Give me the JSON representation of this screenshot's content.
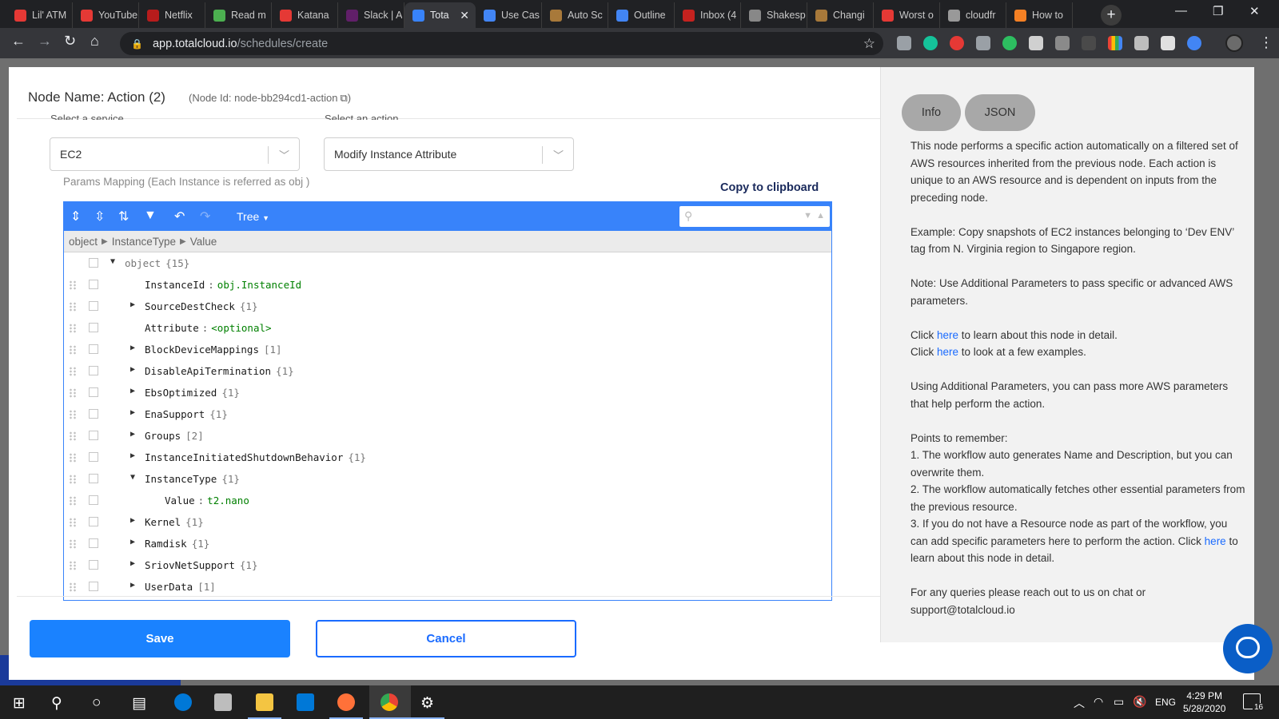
{
  "browser": {
    "tabs": [
      {
        "label": "Lil' ATM",
        "color": "#e53935"
      },
      {
        "label": "YouTube",
        "color": "#e53935"
      },
      {
        "label": "Netflix",
        "color": "#b71c1c"
      },
      {
        "label": "Read m",
        "color": "#4caf50"
      },
      {
        "label": "Katana",
        "color": "#e53935"
      },
      {
        "label": "Slack | A",
        "color": "#611f69"
      },
      {
        "label": "Tota",
        "color": "#3883fa",
        "active": true
      },
      {
        "label": "Use Cas",
        "color": "#4285f4"
      },
      {
        "label": "Auto Sc",
        "color": "#a8793a"
      },
      {
        "label": "Outline",
        "color": "#4285f4"
      },
      {
        "label": "Inbox (4",
        "color": "#c5221f"
      },
      {
        "label": "Shakesp",
        "color": "#888888"
      },
      {
        "label": "Changi",
        "color": "#a8793a"
      },
      {
        "label": "Worst o",
        "color": "#e53935"
      },
      {
        "label": "cloudfr",
        "color": "#999999"
      },
      {
        "label": "How to",
        "color": "#f48024"
      }
    ],
    "url_domain": "app.totalcloud.io",
    "url_path": "/schedules/create"
  },
  "modal": {
    "node_name": "Node Name: Action (2)",
    "node_id": "(Node Id: node-bb294cd1-action",
    "service_label": "Select a service",
    "action_label": "Select an action",
    "service_value": "EC2",
    "action_value": "Modify Instance Attribute",
    "params_label": "Params Mapping (Each Instance is referred as obj )",
    "copy_clipboard": "Copy to clipboard",
    "editor": {
      "mode": "Tree",
      "path": [
        "object",
        "InstanceType",
        "Value"
      ],
      "rows": [
        {
          "indent": 0,
          "expander": "open",
          "key": "object",
          "count": "{15}",
          "handle": false
        },
        {
          "indent": 1,
          "expander": "none",
          "key": "InstanceId",
          "value": "obj.InstanceId"
        },
        {
          "indent": 1,
          "expander": "closed",
          "key": "SourceDestCheck",
          "count": "{1}"
        },
        {
          "indent": 1,
          "expander": "none",
          "key": "Attribute",
          "value": "<optional>"
        },
        {
          "indent": 1,
          "expander": "closed",
          "key": "BlockDeviceMappings",
          "count": "[1]"
        },
        {
          "indent": 1,
          "expander": "closed",
          "key": "DisableApiTermination",
          "count": "{1}"
        },
        {
          "indent": 1,
          "expander": "closed",
          "key": "EbsOptimized",
          "count": "{1}"
        },
        {
          "indent": 1,
          "expander": "closed",
          "key": "EnaSupport",
          "count": "{1}"
        },
        {
          "indent": 1,
          "expander": "closed",
          "key": "Groups",
          "count": "[2]"
        },
        {
          "indent": 1,
          "expander": "closed",
          "key": "InstanceInitiatedShutdownBehavior",
          "count": "{1}"
        },
        {
          "indent": 1,
          "expander": "open",
          "key": "InstanceType",
          "count": "{1}"
        },
        {
          "indent": 2,
          "expander": "none",
          "key": "Value",
          "value": "t2.nano"
        },
        {
          "indent": 1,
          "expander": "closed",
          "key": "Kernel",
          "count": "{1}"
        },
        {
          "indent": 1,
          "expander": "closed",
          "key": "Ramdisk",
          "count": "{1}"
        },
        {
          "indent": 1,
          "expander": "closed",
          "key": "SriovNetSupport",
          "count": "{1}"
        },
        {
          "indent": 1,
          "expander": "closed",
          "key": "UserData",
          "count": "[1]"
        }
      ]
    },
    "save_label": "Save",
    "cancel_label": "Cancel"
  },
  "info_panel": {
    "tabs": [
      "Info",
      "JSON"
    ],
    "p1": "This node performs a specific action automatically on a filtered set of AWS resources inherited from the previous node. Each action is unique to an AWS resource and is dependent on inputs from the preceding node.",
    "p2": "Example: Copy snapshots of EC2 instances belonging to ‘Dev ENV’ tag from N. Virginia region to Singapore region.",
    "p3": "Note: Use Additional Parameters to pass specific or advanced AWS parameters.",
    "click_prefix": "Click ",
    "here": "here",
    "click1_suffix": " to learn about this node in detail.",
    "click2_suffix": " to look at a few examples.",
    "p5": "Using Additional Parameters, you can pass more AWS parameters that help perform the action.",
    "points_title": "Points to remember:",
    "point1": "1. The workflow auto generates Name and Description, but you can overwrite them.",
    "point2": "2. The workflow automatically fetches other essential parameters from the previous resource.",
    "point3": "3. If you do not have a Resource node as part of the workflow, you can add specific parameters here to perform the action. Click ",
    "point3_suffix": " to learn about this node in detail.",
    "queries": "For any queries please reach out to us on chat or support@totalcloud.io"
  },
  "taskbar": {
    "lang": "ENG",
    "time": "4:29 PM",
    "date": "5/28/2020",
    "notifications": "16"
  }
}
